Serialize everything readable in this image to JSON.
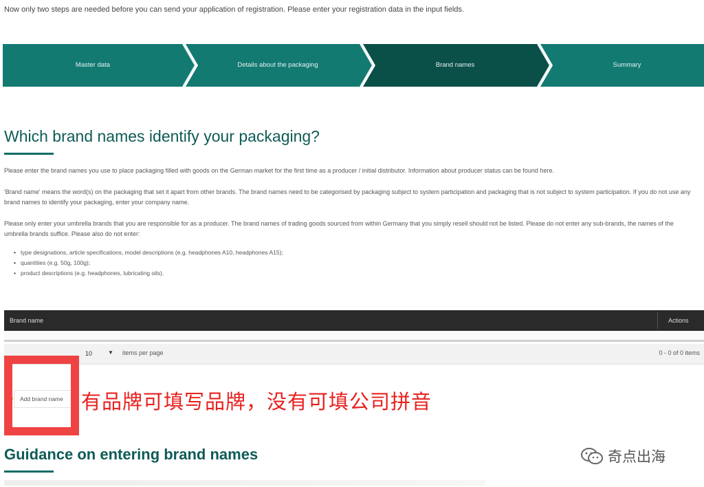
{
  "intro": "Now only two steps are needed before you can send your application of registration. Please enter your registration data in the input fields.",
  "steps": [
    {
      "label": "Master data",
      "state": "done"
    },
    {
      "label": "Details about the packaging",
      "state": "done"
    },
    {
      "label": "Brand names",
      "state": "current"
    },
    {
      "label": "Summary",
      "state": "upcoming"
    }
  ],
  "colors": {
    "step_done": "#137a72",
    "step_current": "#0b4f49",
    "heading": "#0e5b56",
    "annotation": "#e8211f",
    "highlight": "#ef4343",
    "table_header": "#2a2a2a"
  },
  "main": {
    "heading": "Which brand names identify your packaging?",
    "paragraphs": [
      "Please enter the brand names you use to place packaging filled with goods on the German market for the first time as a producer / initial distributor. Information about producer status can be found here.",
      "'Brand name' means the word(s) on the packaging that set it apart from other brands. The brand names need to be categorised by packaging subject to system participation and packaging that is not subject to system participation. If you do not use any brand names to identify your packaging, enter your company name.",
      "Please only enter your umbrella brands that you are responsible for as a producer. The brand names of trading goods sourced from within Germany that you simply resell should not be listed. Please do not enter any sub-brands, the names of the umbrella brands suffice. Please also do not enter:"
    ],
    "bullets": [
      "type designations, article specifications, model descriptions (e.g. headphones A10, headphones A15);",
      "quantities (e.g. 50g, 100g);",
      "product descriptions (e.g. headphones, lubricating oils)."
    ]
  },
  "table": {
    "col_brand": "Brand name",
    "col_actions": "Actions",
    "page_size": "10",
    "items_per_page": "items per page",
    "count": "0 - 0 of 0 items"
  },
  "add_button": "Add brand name",
  "annotation": "有品牌可填写品牌，没有可填公司拼音",
  "guidance_heading": "Guidance on entering brand names",
  "watermark": "奇点出海"
}
